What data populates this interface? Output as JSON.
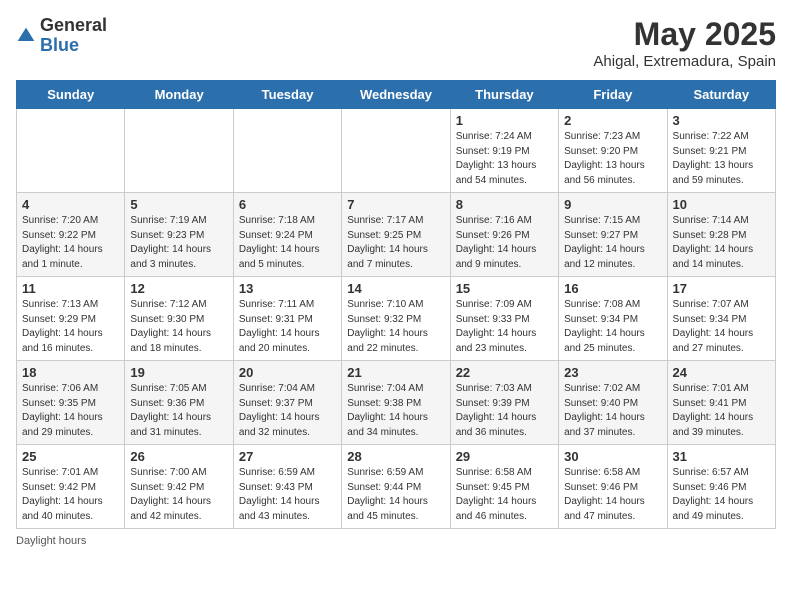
{
  "header": {
    "logo_general": "General",
    "logo_blue": "Blue",
    "month_title": "May 2025",
    "location": "Ahigal, Extremadura, Spain"
  },
  "days_of_week": [
    "Sunday",
    "Monday",
    "Tuesday",
    "Wednesday",
    "Thursday",
    "Friday",
    "Saturday"
  ],
  "weeks": [
    [
      {
        "day": "",
        "info": ""
      },
      {
        "day": "",
        "info": ""
      },
      {
        "day": "",
        "info": ""
      },
      {
        "day": "",
        "info": ""
      },
      {
        "day": "1",
        "info": "Sunrise: 7:24 AM\nSunset: 9:19 PM\nDaylight: 13 hours\nand 54 minutes."
      },
      {
        "day": "2",
        "info": "Sunrise: 7:23 AM\nSunset: 9:20 PM\nDaylight: 13 hours\nand 56 minutes."
      },
      {
        "day": "3",
        "info": "Sunrise: 7:22 AM\nSunset: 9:21 PM\nDaylight: 13 hours\nand 59 minutes."
      }
    ],
    [
      {
        "day": "4",
        "info": "Sunrise: 7:20 AM\nSunset: 9:22 PM\nDaylight: 14 hours\nand 1 minute."
      },
      {
        "day": "5",
        "info": "Sunrise: 7:19 AM\nSunset: 9:23 PM\nDaylight: 14 hours\nand 3 minutes."
      },
      {
        "day": "6",
        "info": "Sunrise: 7:18 AM\nSunset: 9:24 PM\nDaylight: 14 hours\nand 5 minutes."
      },
      {
        "day": "7",
        "info": "Sunrise: 7:17 AM\nSunset: 9:25 PM\nDaylight: 14 hours\nand 7 minutes."
      },
      {
        "day": "8",
        "info": "Sunrise: 7:16 AM\nSunset: 9:26 PM\nDaylight: 14 hours\nand 9 minutes."
      },
      {
        "day": "9",
        "info": "Sunrise: 7:15 AM\nSunset: 9:27 PM\nDaylight: 14 hours\nand 12 minutes."
      },
      {
        "day": "10",
        "info": "Sunrise: 7:14 AM\nSunset: 9:28 PM\nDaylight: 14 hours\nand 14 minutes."
      }
    ],
    [
      {
        "day": "11",
        "info": "Sunrise: 7:13 AM\nSunset: 9:29 PM\nDaylight: 14 hours\nand 16 minutes."
      },
      {
        "day": "12",
        "info": "Sunrise: 7:12 AM\nSunset: 9:30 PM\nDaylight: 14 hours\nand 18 minutes."
      },
      {
        "day": "13",
        "info": "Sunrise: 7:11 AM\nSunset: 9:31 PM\nDaylight: 14 hours\nand 20 minutes."
      },
      {
        "day": "14",
        "info": "Sunrise: 7:10 AM\nSunset: 9:32 PM\nDaylight: 14 hours\nand 22 minutes."
      },
      {
        "day": "15",
        "info": "Sunrise: 7:09 AM\nSunset: 9:33 PM\nDaylight: 14 hours\nand 23 minutes."
      },
      {
        "day": "16",
        "info": "Sunrise: 7:08 AM\nSunset: 9:34 PM\nDaylight: 14 hours\nand 25 minutes."
      },
      {
        "day": "17",
        "info": "Sunrise: 7:07 AM\nSunset: 9:34 PM\nDaylight: 14 hours\nand 27 minutes."
      }
    ],
    [
      {
        "day": "18",
        "info": "Sunrise: 7:06 AM\nSunset: 9:35 PM\nDaylight: 14 hours\nand 29 minutes."
      },
      {
        "day": "19",
        "info": "Sunrise: 7:05 AM\nSunset: 9:36 PM\nDaylight: 14 hours\nand 31 minutes."
      },
      {
        "day": "20",
        "info": "Sunrise: 7:04 AM\nSunset: 9:37 PM\nDaylight: 14 hours\nand 32 minutes."
      },
      {
        "day": "21",
        "info": "Sunrise: 7:04 AM\nSunset: 9:38 PM\nDaylight: 14 hours\nand 34 minutes."
      },
      {
        "day": "22",
        "info": "Sunrise: 7:03 AM\nSunset: 9:39 PM\nDaylight: 14 hours\nand 36 minutes."
      },
      {
        "day": "23",
        "info": "Sunrise: 7:02 AM\nSunset: 9:40 PM\nDaylight: 14 hours\nand 37 minutes."
      },
      {
        "day": "24",
        "info": "Sunrise: 7:01 AM\nSunset: 9:41 PM\nDaylight: 14 hours\nand 39 minutes."
      }
    ],
    [
      {
        "day": "25",
        "info": "Sunrise: 7:01 AM\nSunset: 9:42 PM\nDaylight: 14 hours\nand 40 minutes."
      },
      {
        "day": "26",
        "info": "Sunrise: 7:00 AM\nSunset: 9:42 PM\nDaylight: 14 hours\nand 42 minutes."
      },
      {
        "day": "27",
        "info": "Sunrise: 6:59 AM\nSunset: 9:43 PM\nDaylight: 14 hours\nand 43 minutes."
      },
      {
        "day": "28",
        "info": "Sunrise: 6:59 AM\nSunset: 9:44 PM\nDaylight: 14 hours\nand 45 minutes."
      },
      {
        "day": "29",
        "info": "Sunrise: 6:58 AM\nSunset: 9:45 PM\nDaylight: 14 hours\nand 46 minutes."
      },
      {
        "day": "30",
        "info": "Sunrise: 6:58 AM\nSunset: 9:46 PM\nDaylight: 14 hours\nand 47 minutes."
      },
      {
        "day": "31",
        "info": "Sunrise: 6:57 AM\nSunset: 9:46 PM\nDaylight: 14 hours\nand 49 minutes."
      }
    ]
  ],
  "footer": {
    "note": "Daylight hours"
  }
}
